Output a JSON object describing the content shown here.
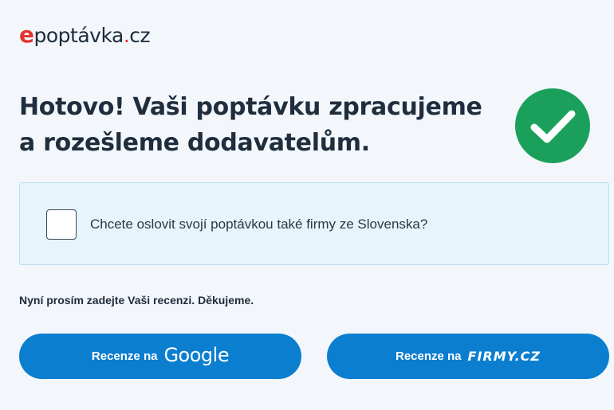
{
  "logo": {
    "e": "e",
    "main": "poptávka",
    "dot": ".",
    "tld": "cz"
  },
  "title": "Hotovo! Vaši poptávku zpracujeme a rozešleme dodavatelům.",
  "success_icon": "check-circle-icon",
  "slovakia_option": {
    "label": "Chcete oslovit svojí poptávkou také firmy ze Slovenska?",
    "checked": false
  },
  "review_note": "Nyní prosím zadejte Vaši recenzi. Děkujeme.",
  "buttons": {
    "google": {
      "label": "Recenze na",
      "brand": "Google"
    },
    "firmy": {
      "label": "Recenze na",
      "brand": "FIRMY.CZ"
    }
  },
  "colors": {
    "accent": "#0b7ecf",
    "success": "#1aa05b",
    "logo_red": "#e3342f"
  }
}
